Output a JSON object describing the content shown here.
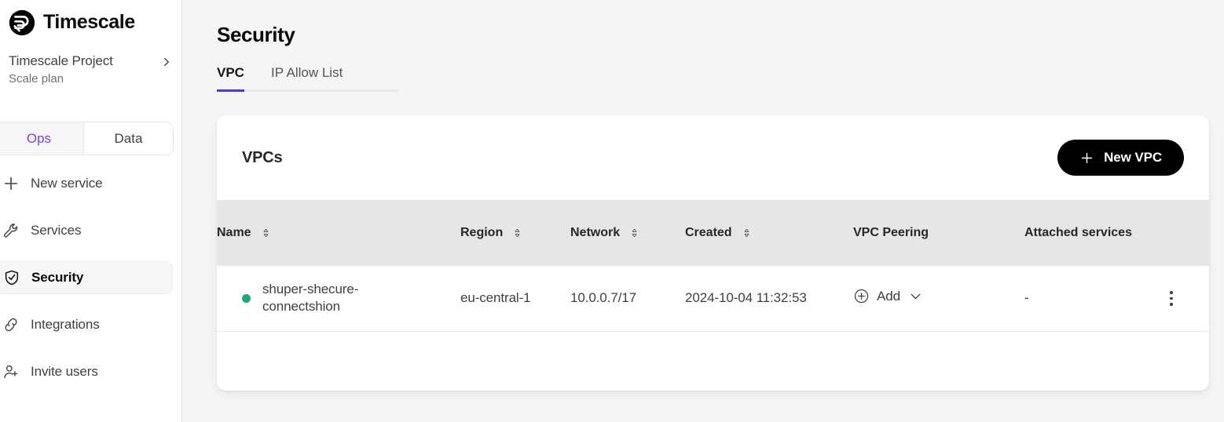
{
  "sidebar": {
    "brand": {
      "name": "Timescale",
      "logo_icon": "timescale-logo-icon"
    },
    "project": {
      "name": "Timescale Project",
      "plan": "Scale plan",
      "chevron_icon": "chevron-right-icon"
    },
    "segmented": {
      "options": [
        {
          "label": "Ops",
          "active": true
        },
        {
          "label": "Data",
          "active": false
        }
      ],
      "active_color": "#7b3ff2"
    },
    "nav_items": [
      {
        "label": "New service",
        "icon": "plus-icon",
        "active": false
      },
      {
        "label": "Services",
        "icon": "wrench-icon",
        "active": false
      },
      {
        "label": "Security",
        "icon": "shield-check-icon",
        "active": true
      },
      {
        "label": "Integrations",
        "icon": "link-icon",
        "active": false
      },
      {
        "label": "Invite users",
        "icon": "user-plus-icon",
        "active": false
      }
    ]
  },
  "main": {
    "page_title": "Security",
    "tabs": [
      {
        "label": "VPC",
        "active": true
      },
      {
        "label": "IP Allow List",
        "active": false
      }
    ],
    "tab_underline_color": "#4f35e8",
    "card": {
      "title": "VPCs",
      "new_button": {
        "label": "New VPC",
        "icon": "plus-icon"
      },
      "table": {
        "columns": [
          {
            "key": "name",
            "label": "Name",
            "sortable": true,
            "sort_icon": "sort-updown-icon"
          },
          {
            "key": "region",
            "label": "Region",
            "sortable": true,
            "sort_icon": "sort-updown-icon"
          },
          {
            "key": "network",
            "label": "Network",
            "sortable": true,
            "sort_icon": "sort-updown-icon"
          },
          {
            "key": "created",
            "label": "Created",
            "sortable": true,
            "sort_icon": "sort-updown-icon"
          },
          {
            "key": "peering",
            "label": "VPC Peering",
            "sortable": false
          },
          {
            "key": "attached",
            "label": "Attached services",
            "sortable": false
          },
          {
            "key": "actions",
            "label": "",
            "sortable": false
          }
        ],
        "rows": [
          {
            "status": "active",
            "status_color": "#1aa87c",
            "name": "shuper-shecure-connectshion",
            "region": "eu-central-1",
            "network": "10.0.0.7/17",
            "created": "2024-10-04 11:32:53",
            "peering_label": "Add",
            "peering_add_icon": "plus-circle-icon",
            "peering_chevron_icon": "chevron-down-icon",
            "attached_services": "-",
            "actions_icon": "kebab-menu-icon"
          }
        ]
      }
    }
  }
}
